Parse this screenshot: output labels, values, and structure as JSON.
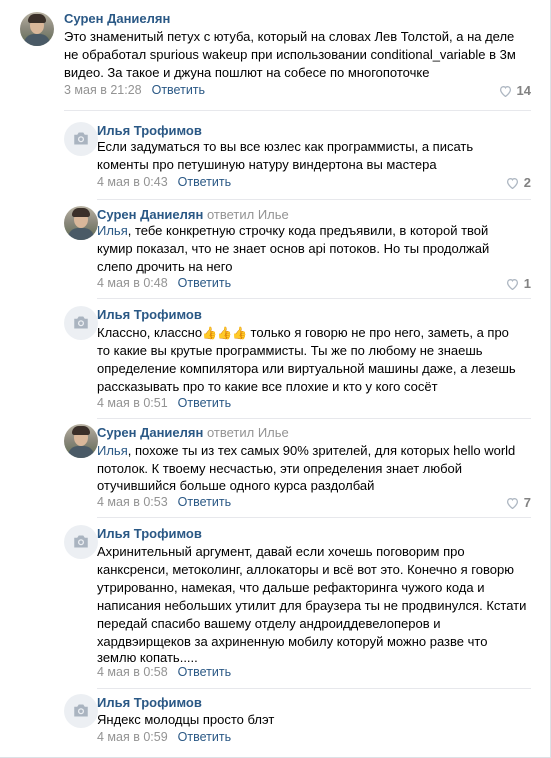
{
  "comments": [
    {
      "author": "Сурен Даниелян",
      "avatar": "user-photo",
      "lines": [
        "Это знаменитый петух с ютуба, который на словах Лев Толстой, а на деле",
        "не обработал spurious wakeup при использовании conditional_variable в 3м",
        "видео. За такое и джуна пошлют на собесе по многопоточке"
      ],
      "date": "3 мая в 21:28",
      "reply": "Ответить",
      "likes": "14"
    },
    {
      "author": "Илья Трофимов",
      "avatar": "camera-placeholder",
      "lines": [
        "Если задуматься то вы все юзлес как программисты, а писать",
        "коменты про петушиную натуру виндертона вы мастера"
      ],
      "date": "4 мая в 0:43",
      "reply": "Ответить",
      "likes": "2"
    },
    {
      "author": "Сурен Даниелян",
      "replied": "ответил Илье",
      "avatar": "user-photo",
      "mention": "Илья",
      "lines": [
        ", тебе конкретную строчку кода предъявили, в которой твой",
        "кумир показал, что не знает основ api потоков. Но ты продолжай",
        "слепо дрочить на него"
      ],
      "date": "4 мая в 0:48",
      "reply": "Ответить",
      "likes": "1"
    },
    {
      "author": "Илья Трофимов",
      "avatar": "camera-placeholder",
      "first_line_start": "Классно, классно",
      "thumbs": "👍👍👍",
      "first_line_end": " только я говорю не про него, заметь, а про",
      "lines": [
        "то какие вы крутые программисты. Ты же по любому не знаешь",
        "определение компилятора или виртуальной машины даже, а лезешь",
        "рассказывать про то какие все плохие и кто у кого сосёт"
      ],
      "date": "4 мая в 0:51",
      "reply": "Ответить",
      "likes": ""
    },
    {
      "author": "Сурен Даниелян",
      "replied": "ответил Илье",
      "avatar": "user-photo",
      "mention": "Илья",
      "lines": [
        ", похоже ты из тех самых 90% зрителей, для которых hello world",
        "потолок. К твоему несчастью, эти определения знает любой",
        "отучившийся больше одного курса раздолбай"
      ],
      "date": "4 мая в 0:53",
      "reply": "Ответить",
      "likes": "7"
    },
    {
      "author": "Илья Трофимов",
      "avatar": "camera-placeholder",
      "lines": [
        "Ахринительный аргумент, давай если хочешь поговорим про",
        "канксренси, метоколинг, аллокаторы и всё вот это. Конечно я говорю",
        "утрированно, намекая, что дальше рефакторинга чужого кода и",
        "написания небольших утилит для браузера ты не продвинулся. Кстати",
        "передай спасибо вашему отделу андроиддевелоперов и",
        "хардвэирщеков за ахриненную мобилу которуй можно разве что",
        "землю копать....."
      ],
      "date": "4 мая в 0:58",
      "reply": "Ответить",
      "likes": ""
    },
    {
      "author": "Илья Трофимов",
      "avatar": "camera-placeholder",
      "lines": [
        "Яндекс молодцы просто блэт"
      ],
      "date": "4 мая в 0:59",
      "reply": "Ответить",
      "likes": ""
    }
  ],
  "colors": {
    "link": "#2a5885",
    "meta": "#939393",
    "divider": "#e7e8ec"
  },
  "icons": {
    "like": "heart-icon",
    "placeholder": "camera-icon"
  }
}
